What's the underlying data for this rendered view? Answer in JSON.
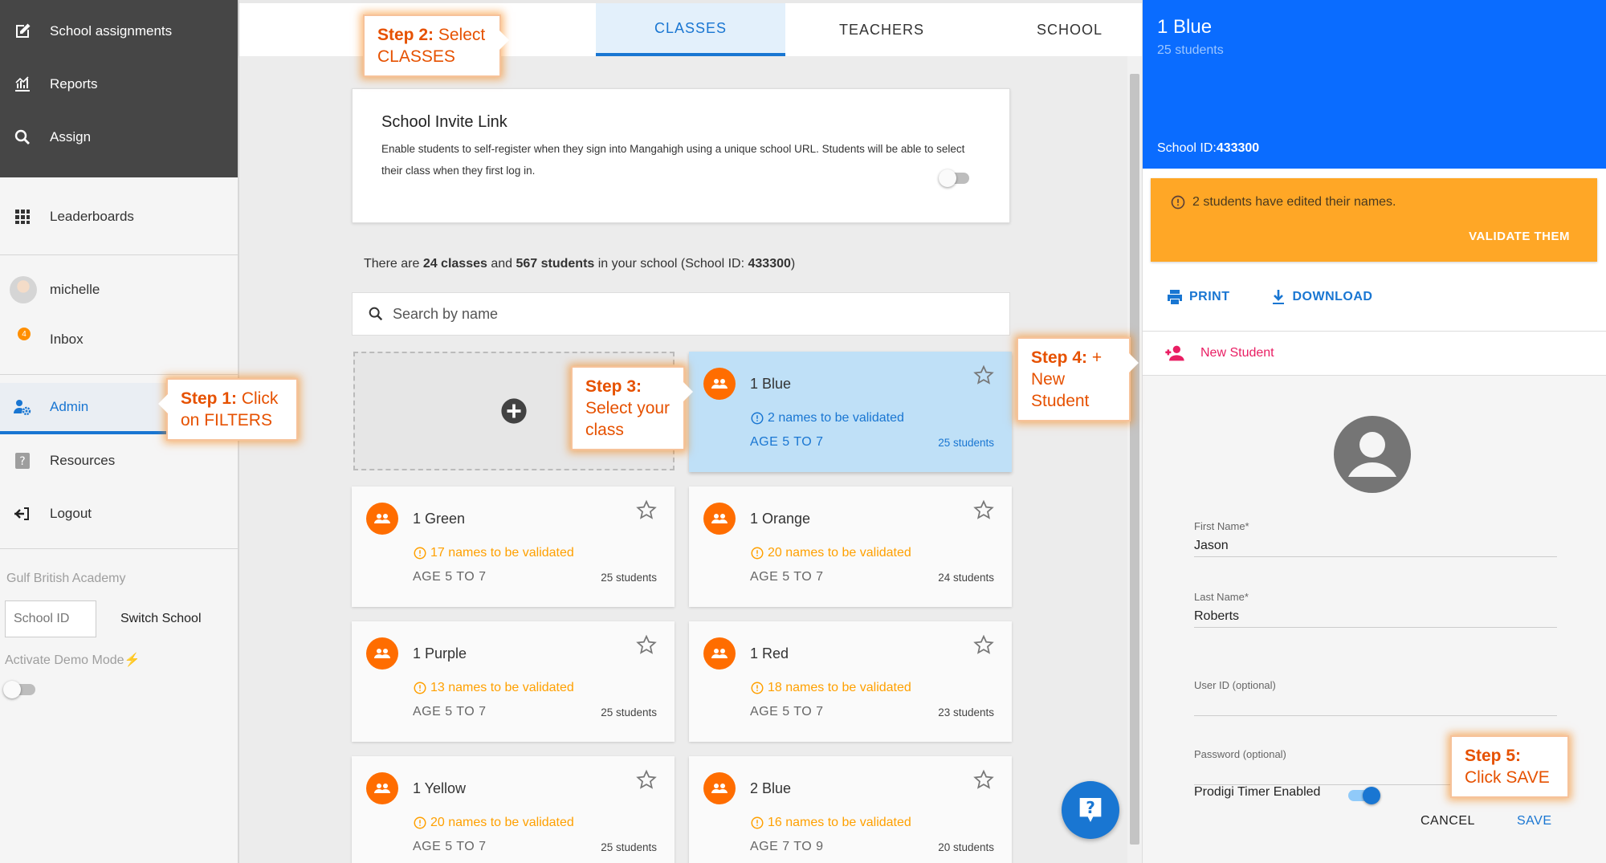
{
  "sidebar": {
    "items": [
      {
        "label": "School assignments",
        "icon": "edit-icon"
      },
      {
        "label": "Reports",
        "icon": "chart-icon"
      },
      {
        "label": "Assign",
        "icon": "search-icon"
      },
      {
        "label": "Leaderboards",
        "icon": "grid-icon"
      },
      {
        "label": "michelle",
        "icon": "avatar"
      },
      {
        "label": "Inbox",
        "badge": "4"
      },
      {
        "label": "Admin",
        "icon": "admin-gear-icon"
      },
      {
        "label": "Resources",
        "icon": "help-icon"
      },
      {
        "label": "Logout",
        "icon": "logout-icon"
      }
    ],
    "school_name": "Gulf British Academy",
    "school_id_placeholder": "School ID",
    "switch_school": "Switch School",
    "demo_mode": "Activate Demo Mode"
  },
  "tabs": [
    "CLASSES",
    "TEACHERS",
    "SCHOOL"
  ],
  "invite": {
    "title": "School Invite Link",
    "description": "Enable students to self-register when they sign into Mangahigh using a unique school URL. Students will be able to select their class when they first log in."
  },
  "summary": {
    "prefix": "There are ",
    "classes": "24 classes",
    "middle": " and ",
    "students": "567 students",
    "suffix_pre": " in your school (School ID: ",
    "school_id": "433300",
    "suffix_post": ")"
  },
  "search": {
    "placeholder": "Search by name"
  },
  "classes": [
    {
      "name": "1 Blue",
      "validate": "2 names to be validated",
      "age": "AGE 5 TO 7",
      "students": "25 students",
      "selected": true
    },
    {
      "name": "1 Green",
      "validate": "17 names to be validated",
      "age": "AGE 5 TO 7",
      "students": "25 students"
    },
    {
      "name": "1 Orange",
      "validate": "20 names to be validated",
      "age": "AGE 5 TO 7",
      "students": "24 students"
    },
    {
      "name": "1 Purple",
      "validate": "13 names to be validated",
      "age": "AGE 5 TO 7",
      "students": "25 students"
    },
    {
      "name": "1 Red",
      "validate": "18 names to be validated",
      "age": "AGE 5 TO 7",
      "students": "23 students"
    },
    {
      "name": "1 Yellow",
      "validate": "20 names to be validated",
      "age": "AGE 5 TO 7",
      "students": "25 students"
    },
    {
      "name": "2 Blue",
      "validate": "16 names to be validated",
      "age": "AGE 7 TO 9",
      "students": "20 students"
    }
  ],
  "panel": {
    "title": "1 Blue",
    "subtitle": "25 students",
    "school_id_label": "School ID:",
    "school_id": "433300",
    "alert_text": "2 students have edited their names.",
    "alert_button": "VALIDATE THEM",
    "print": "PRINT",
    "download": "DOWNLOAD",
    "new_student": "New Student",
    "fields": [
      {
        "label": "First Name*",
        "value": "Jason"
      },
      {
        "label": "Last Name*",
        "value": "Roberts"
      },
      {
        "label": "User ID (optional)",
        "value": ""
      },
      {
        "label": "Password (optional)",
        "value": ""
      }
    ],
    "timer_label": "Prodigi Timer Enabled",
    "cancel": "CANCEL",
    "save": "SAVE"
  },
  "callouts": {
    "step1": {
      "step": "Step 1:",
      "text": " Click on FILTERS"
    },
    "step2": {
      "step": "Step 2:",
      "text": " Select CLASSES"
    },
    "step3": {
      "step": "Step 3:",
      "text": " Select your class"
    },
    "step4": {
      "step": "Step 4:",
      "text": " + New Student"
    },
    "step5": {
      "step": "Step 5:",
      "text": " Click SAVE"
    }
  },
  "colors": {
    "primary_blue": "#1976d2",
    "header_blue": "#0a6cff",
    "orange_icon": "#ff6d00",
    "validation_orange": "#ffa000",
    "alert_orange": "#ffa726",
    "new_student_pink": "#e91e63",
    "sidebar_dark": "#464646"
  }
}
